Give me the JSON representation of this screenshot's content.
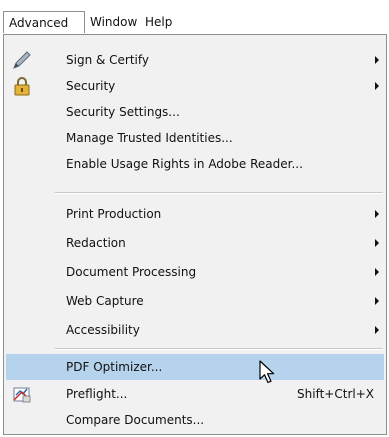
{
  "menubar": {
    "items": [
      "Advanced",
      "Window",
      "Help"
    ]
  },
  "menu": {
    "items": [
      {
        "label": "Sign & Certify",
        "icon": "pen-icon",
        "submenu": true
      },
      {
        "label": "Security",
        "icon": "padlock-icon",
        "submenu": true
      },
      {
        "label": "Security Settings...",
        "submenu": false
      },
      {
        "label": "Manage Trusted Identities...",
        "submenu": false
      },
      {
        "label": "Enable Usage Rights in Adobe Reader...",
        "submenu": false
      },
      {
        "label": "Print Production",
        "submenu": true
      },
      {
        "label": "Redaction",
        "submenu": true
      },
      {
        "label": "Document Processing",
        "submenu": true
      },
      {
        "label": "Web Capture",
        "submenu": true
      },
      {
        "label": "Accessibility",
        "submenu": true
      },
      {
        "label": "PDF Optimizer...",
        "submenu": false,
        "highlighted": true
      },
      {
        "label": "Preflight...",
        "icon": "preflight-icon",
        "shortcut": "Shift+Ctrl+X",
        "submenu": false
      },
      {
        "label": "Compare Documents...",
        "submenu": false
      }
    ]
  },
  "colors": {
    "menu_background": "#f1f1f1",
    "highlight": "#b5d3ec",
    "border": "#8f8f8f"
  }
}
